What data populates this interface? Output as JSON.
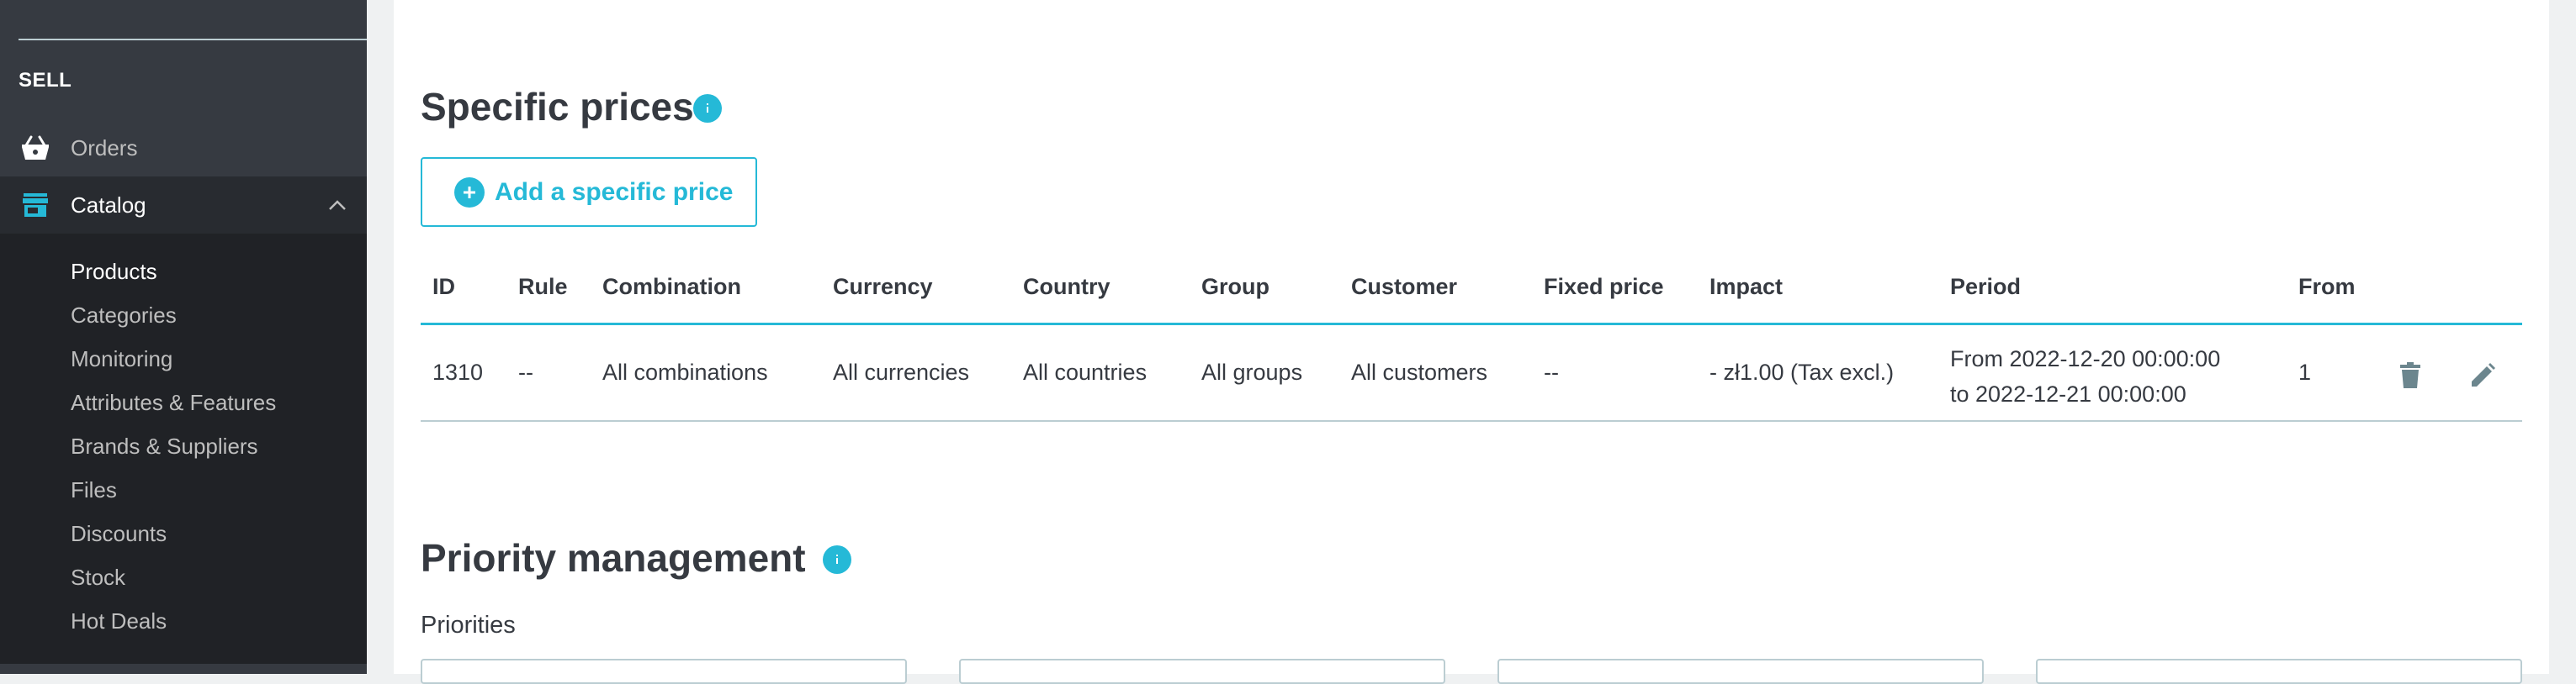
{
  "sidebar": {
    "section_title": "SELL",
    "orders": {
      "label": "Orders",
      "icon": "basket-icon"
    },
    "catalog": {
      "label": "Catalog",
      "icon": "store-icon",
      "expanded": true
    },
    "submenu": [
      {
        "label": "Products",
        "active": true
      },
      {
        "label": "Categories"
      },
      {
        "label": "Monitoring"
      },
      {
        "label": "Attributes & Features"
      },
      {
        "label": "Brands & Suppliers"
      },
      {
        "label": "Files"
      },
      {
        "label": "Discounts"
      },
      {
        "label": "Stock"
      },
      {
        "label": "Hot Deals"
      }
    ]
  },
  "specific_prices": {
    "title": "Specific prices",
    "add_button_label": "Add a specific price",
    "columns": [
      "ID",
      "Rule",
      "Combination",
      "Currency",
      "Country",
      "Group",
      "Customer",
      "Fixed price",
      "Impact",
      "Period",
      "From"
    ],
    "rows": [
      {
        "id": "1310",
        "rule": "--",
        "combination": "All combinations",
        "currency": "All currencies",
        "country": "All countries",
        "group": "All groups",
        "customer": "All customers",
        "fixed_price": "--",
        "impact": "- zł1.00 (Tax excl.)",
        "period_from": "From 2022-12-20 00:00:00",
        "period_to": "to 2022-12-21 00:00:00",
        "from": "1"
      }
    ]
  },
  "priority_management": {
    "title": "Priority management",
    "priorities_label": "Priorities"
  },
  "colors": {
    "accent": "#25b9d7",
    "sidebar_bg": "#363a41",
    "text": "#363a41",
    "border": "#bbcdd2"
  }
}
